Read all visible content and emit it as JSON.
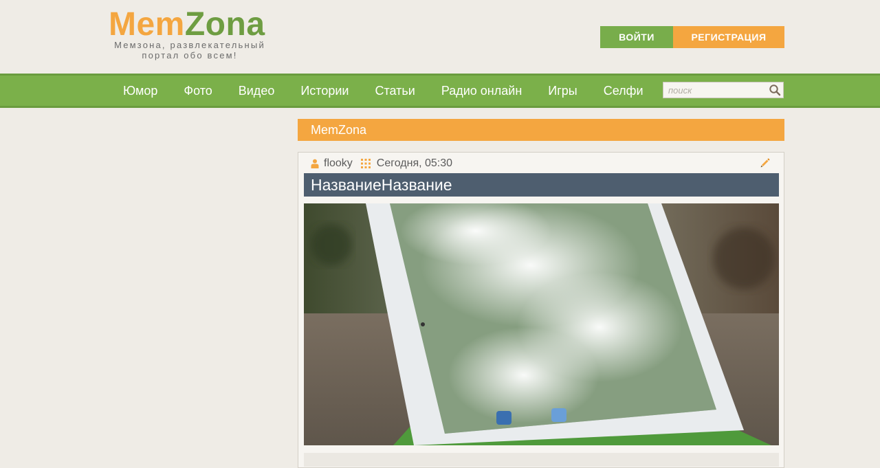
{
  "logo": {
    "part1": "Mem",
    "part2": "Zona",
    "tagline_line1": "Мемзона, развлекательный",
    "tagline_line2": "портал обо всем!"
  },
  "auth": {
    "login_label": "ВОЙТИ",
    "register_label": "РЕГИСТРАЦИЯ"
  },
  "nav": {
    "items": [
      "Юмор",
      "Фото",
      "Видео",
      "Истории",
      "Статьи",
      "Радио онлайн",
      "Игры",
      "Селфи"
    ]
  },
  "search": {
    "placeholder": "поиск",
    "icon": "search-icon"
  },
  "section": {
    "title": "MemZona"
  },
  "post": {
    "author": "flooky",
    "author_icon": "user-icon",
    "category_icon": "grid-icon",
    "date": "Сегодня, 05:30",
    "edit_icon": "pencil-icon",
    "title": "НазваниеНазвание",
    "image_description_icon": "photo"
  },
  "colors": {
    "background": "#efece6",
    "green": "#7bb04a",
    "orange": "#f4a640",
    "title_bar": "#4e5e6f"
  }
}
